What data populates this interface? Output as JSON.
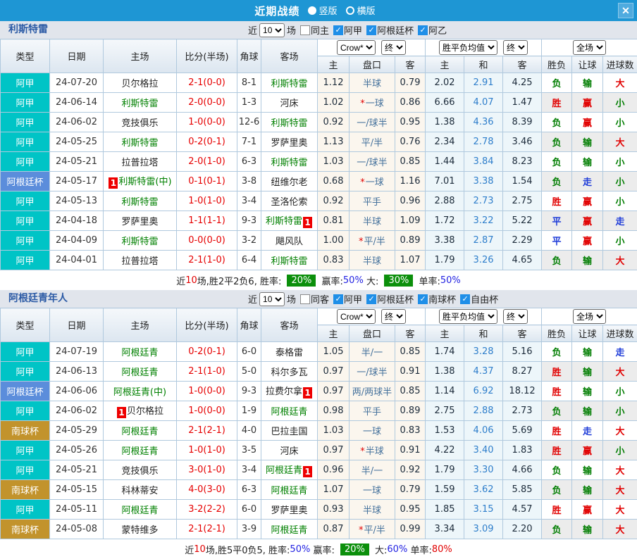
{
  "titlebar": {
    "title": "近期战绩",
    "view_modes": [
      {
        "label": "竖版",
        "selected": true
      },
      {
        "label": "横版",
        "selected": false
      }
    ],
    "close_label": "✕"
  },
  "table_head": {
    "main": [
      "类型",
      "日期",
      "主场",
      "比分(半场)",
      "角球",
      "客场"
    ],
    "odds": [
      "主",
      "盘口",
      "客"
    ],
    "avg": [
      "主",
      "和",
      "客"
    ],
    "result": [
      "胜负",
      "让球",
      "进球数"
    ]
  },
  "colors": {
    "topbar": "#1e96d4",
    "league": {
      "阿甲": "#00c4c6",
      "阿根廷杯": "#5b8ddb",
      "南球杯": "#c2932c"
    },
    "win_red": "#e10000",
    "lose_green": "#007d00",
    "draw_blue": "#1f3cd8"
  },
  "sections": [
    {
      "team": "利斯特雷",
      "filter": {
        "prefix": "近",
        "count": "10",
        "suffix": "场",
        "checkboxes": [
          {
            "label": "同主",
            "checked": false
          },
          {
            "label": "阿甲",
            "checked": true
          },
          {
            "label": "阿根廷杯",
            "checked": true
          },
          {
            "label": "阿乙",
            "checked": true
          }
        ]
      },
      "dropdowns": {
        "book": "Crow*",
        "book_period": "终",
        "avg": "胜平负均值",
        "avg_period": "终",
        "scope": "全场"
      },
      "rows": [
        {
          "lg": "阿甲",
          "date": "24-07-20",
          "home": {
            "t": "贝尔格拉"
          },
          "score": "2-1",
          "half": "(0-0)",
          "cor": "8-1",
          "away": {
            "t": "利斯特雷",
            "g": 1
          },
          "o1": "1.12",
          "hcap": "半球",
          "star": 0,
          "o2": "0.79",
          "a1": "2.02",
          "a2": "2.91",
          "a3": "4.25",
          "r": "负",
          "h": "输",
          "gl": "大"
        },
        {
          "lg": "阿甲",
          "date": "24-06-14",
          "home": {
            "t": "利斯特雷",
            "g": 1
          },
          "score": "2-0",
          "half": "(0-0)",
          "cor": "1-3",
          "away": {
            "t": "河床"
          },
          "o1": "1.02",
          "hcap": "一球",
          "star": 1,
          "o2": "0.86",
          "a1": "6.66",
          "a2": "4.07",
          "a3": "1.47",
          "r": "胜",
          "h": "赢",
          "gl": "小"
        },
        {
          "lg": "阿甲",
          "date": "24-06-02",
          "home": {
            "t": "竞技俱乐"
          },
          "score": "1-0",
          "half": "(0-0)",
          "cor": "12-6",
          "away": {
            "t": "利斯特雷",
            "g": 1
          },
          "o1": "0.92",
          "hcap": "一/球半",
          "star": 0,
          "o2": "0.95",
          "a1": "1.38",
          "a2": "4.36",
          "a3": "8.39",
          "r": "负",
          "h": "赢",
          "gl": "小"
        },
        {
          "lg": "阿甲",
          "date": "24-05-25",
          "home": {
            "t": "利斯特雷",
            "g": 1
          },
          "score": "0-2",
          "half": "(0-1)",
          "cor": "7-1",
          "away": {
            "t": "罗萨里奥"
          },
          "o1": "1.13",
          "hcap": "平/半",
          "star": 0,
          "o2": "0.76",
          "a1": "2.34",
          "a2": "2.78",
          "a3": "3.46",
          "r": "负",
          "h": "输",
          "gl": "大"
        },
        {
          "lg": "阿甲",
          "date": "24-05-21",
          "home": {
            "t": "拉普拉塔"
          },
          "score": "2-0",
          "half": "(1-0)",
          "cor": "6-3",
          "away": {
            "t": "利斯特雷",
            "g": 1
          },
          "o1": "1.03",
          "hcap": "一/球半",
          "star": 0,
          "o2": "0.85",
          "a1": "1.44",
          "a2": "3.84",
          "a3": "8.23",
          "r": "负",
          "h": "输",
          "gl": "小"
        },
        {
          "lg": "阿根廷杯",
          "date": "24-05-17",
          "home": {
            "t": "利斯特雷(中)",
            "g": 1,
            "b": "l"
          },
          "score": "0-1",
          "half": "(0-1)",
          "cor": "3-8",
          "away": {
            "t": "纽维尔老"
          },
          "o1": "0.68",
          "hcap": "一球",
          "star": 1,
          "o2": "1.16",
          "a1": "7.01",
          "a2": "3.38",
          "a3": "1.54",
          "r": "负",
          "h": "走",
          "gl": "小"
        },
        {
          "lg": "阿甲",
          "date": "24-05-13",
          "home": {
            "t": "利斯特雷",
            "g": 1
          },
          "score": "1-0",
          "half": "(1-0)",
          "cor": "3-4",
          "away": {
            "t": "圣洛伦索"
          },
          "o1": "0.92",
          "hcap": "平手",
          "star": 0,
          "o2": "0.96",
          "a1": "2.88",
          "a2": "2.73",
          "a3": "2.75",
          "r": "胜",
          "h": "赢",
          "gl": "小"
        },
        {
          "lg": "阿甲",
          "date": "24-04-18",
          "home": {
            "t": "罗萨里奥"
          },
          "score": "1-1",
          "half": "(1-1)",
          "cor": "9-3",
          "away": {
            "t": "利斯特雷",
            "g": 1,
            "b": "r"
          },
          "o1": "0.81",
          "hcap": "半球",
          "star": 0,
          "o2": "1.09",
          "a1": "1.72",
          "a2": "3.22",
          "a3": "5.22",
          "r": "平",
          "h": "赢",
          "gl": "走"
        },
        {
          "lg": "阿甲",
          "date": "24-04-09",
          "home": {
            "t": "利斯特雷",
            "g": 1
          },
          "score": "0-0",
          "half": "(0-0)",
          "cor": "3-2",
          "away": {
            "t": "飓风队"
          },
          "o1": "1.00",
          "hcap": "平/半",
          "star": 1,
          "o2": "0.89",
          "a1": "3.38",
          "a2": "2.87",
          "a3": "2.29",
          "r": "平",
          "h": "赢",
          "gl": "小"
        },
        {
          "lg": "阿甲",
          "date": "24-04-01",
          "home": {
            "t": "拉普拉塔"
          },
          "score": "2-1",
          "half": "(1-0)",
          "cor": "6-4",
          "away": {
            "t": "利斯特雷",
            "g": 1
          },
          "o1": "0.83",
          "hcap": "半球",
          "star": 0,
          "o2": "1.07",
          "a1": "1.79",
          "a2": "3.26",
          "a3": "4.65",
          "r": "负",
          "h": "输",
          "gl": "大"
        }
      ],
      "summary": [
        {
          "t": "近"
        },
        {
          "t": "10",
          "c": "red"
        },
        {
          "t": "场,胜2平2负6, 胜率: "
        },
        {
          "t": "20%",
          "c": "badge"
        },
        {
          "t": " 赢率:"
        },
        {
          "t": "50%",
          "c": "blue"
        },
        {
          "t": " 大: "
        },
        {
          "t": "30%",
          "c": "badge"
        },
        {
          "t": " 单率:"
        },
        {
          "t": "50%",
          "c": "blue"
        }
      ]
    },
    {
      "team": "阿根廷青年人",
      "filter": {
        "prefix": "近",
        "count": "10",
        "suffix": "场",
        "checkboxes": [
          {
            "label": "同客",
            "checked": false
          },
          {
            "label": "阿甲",
            "checked": true
          },
          {
            "label": "阿根廷杯",
            "checked": true
          },
          {
            "label": "南球杯",
            "checked": true
          },
          {
            "label": "自由杯",
            "checked": true
          }
        ]
      },
      "dropdowns": {
        "book": "Crow*",
        "book_period": "终",
        "avg": "胜平负均值",
        "avg_period": "终",
        "scope": "全场"
      },
      "rows": [
        {
          "lg": "阿甲",
          "date": "24-07-19",
          "home": {
            "t": "阿根廷青",
            "g": 1
          },
          "score": "0-2",
          "half": "(0-1)",
          "cor": "6-0",
          "away": {
            "t": "泰格雷"
          },
          "o1": "1.05",
          "hcap": "半/一",
          "star": 0,
          "o2": "0.85",
          "a1": "1.74",
          "a2": "3.28",
          "a3": "5.16",
          "r": "负",
          "h": "输",
          "gl": "走"
        },
        {
          "lg": "阿甲",
          "date": "24-06-13",
          "home": {
            "t": "阿根廷青",
            "g": 1
          },
          "score": "2-1",
          "half": "(1-0)",
          "cor": "5-0",
          "away": {
            "t": "科尔多瓦"
          },
          "o1": "0.97",
          "hcap": "一/球半",
          "star": 0,
          "o2": "0.91",
          "a1": "1.38",
          "a2": "4.37",
          "a3": "8.27",
          "r": "胜",
          "h": "输",
          "gl": "大"
        },
        {
          "lg": "阿根廷杯",
          "date": "24-06-06",
          "home": {
            "t": "阿根廷青(中)",
            "g": 1
          },
          "score": "1-0",
          "half": "(0-0)",
          "cor": "9-3",
          "away": {
            "t": "拉费尔拿",
            "b": "r"
          },
          "o1": "0.97",
          "hcap": "两/两球半",
          "star": 0,
          "o2": "0.85",
          "a1": "1.14",
          "a2": "6.92",
          "a3": "18.12",
          "r": "胜",
          "h": "输",
          "gl": "小"
        },
        {
          "lg": "阿甲",
          "date": "24-06-02",
          "home": {
            "t": "贝尔格拉",
            "b": "l"
          },
          "score": "1-0",
          "half": "(0-0)",
          "cor": "1-9",
          "away": {
            "t": "阿根廷青",
            "g": 1
          },
          "o1": "0.98",
          "hcap": "平手",
          "star": 0,
          "o2": "0.89",
          "a1": "2.75",
          "a2": "2.88",
          "a3": "2.73",
          "r": "负",
          "h": "输",
          "gl": "小"
        },
        {
          "lg": "南球杯",
          "date": "24-05-29",
          "home": {
            "t": "阿根廷青",
            "g": 1
          },
          "score": "2-1",
          "half": "(2-1)",
          "cor": "4-0",
          "away": {
            "t": "巴拉圭国"
          },
          "o1": "1.03",
          "hcap": "一球",
          "star": 0,
          "o2": "0.83",
          "a1": "1.53",
          "a2": "4.06",
          "a3": "5.69",
          "r": "胜",
          "h": "走",
          "gl": "大"
        },
        {
          "lg": "阿甲",
          "date": "24-05-26",
          "home": {
            "t": "阿根廷青",
            "g": 1
          },
          "score": "1-0",
          "half": "(1-0)",
          "cor": "3-5",
          "away": {
            "t": "河床"
          },
          "o1": "0.97",
          "hcap": "半球",
          "star": 1,
          "o2": "0.91",
          "a1": "4.22",
          "a2": "3.40",
          "a3": "1.83",
          "r": "胜",
          "h": "赢",
          "gl": "小"
        },
        {
          "lg": "阿甲",
          "date": "24-05-21",
          "home": {
            "t": "竞技俱乐"
          },
          "score": "3-0",
          "half": "(1-0)",
          "cor": "3-4",
          "away": {
            "t": "阿根廷青",
            "g": 1,
            "b": "r"
          },
          "o1": "0.96",
          "hcap": "半/一",
          "star": 0,
          "o2": "0.92",
          "a1": "1.79",
          "a2": "3.30",
          "a3": "4.66",
          "r": "负",
          "h": "输",
          "gl": "大"
        },
        {
          "lg": "南球杯",
          "date": "24-05-15",
          "home": {
            "t": "科林蒂安"
          },
          "score": "4-0",
          "half": "(3-0)",
          "cor": "6-3",
          "away": {
            "t": "阿根廷青",
            "g": 1
          },
          "o1": "1.07",
          "hcap": "一球",
          "star": 0,
          "o2": "0.79",
          "a1": "1.59",
          "a2": "3.62",
          "a3": "5.85",
          "r": "负",
          "h": "输",
          "gl": "大"
        },
        {
          "lg": "阿甲",
          "date": "24-05-11",
          "home": {
            "t": "阿根廷青",
            "g": 1
          },
          "score": "3-2",
          "half": "(2-2)",
          "cor": "6-0",
          "away": {
            "t": "罗萨里奥"
          },
          "o1": "0.93",
          "hcap": "半球",
          "star": 0,
          "o2": "0.95",
          "a1": "1.85",
          "a2": "3.15",
          "a3": "4.57",
          "r": "胜",
          "h": "赢",
          "gl": "大"
        },
        {
          "lg": "南球杯",
          "date": "24-05-08",
          "home": {
            "t": "蒙特维多"
          },
          "score": "2-1",
          "half": "(2-1)",
          "cor": "3-9",
          "away": {
            "t": "阿根廷青",
            "g": 1
          },
          "o1": "0.87",
          "hcap": "平/半",
          "star": 1,
          "o2": "0.99",
          "a1": "3.34",
          "a2": "3.09",
          "a3": "2.20",
          "r": "负",
          "h": "输",
          "gl": "大"
        }
      ],
      "summary": [
        {
          "t": "近"
        },
        {
          "t": "10",
          "c": "red"
        },
        {
          "t": "场,胜5平0负5, 胜率:"
        },
        {
          "t": "50%",
          "c": "blue"
        },
        {
          "t": " 赢率: "
        },
        {
          "t": "20%",
          "c": "badge"
        },
        {
          "t": " 大:"
        },
        {
          "t": "60%",
          "c": "blue"
        },
        {
          "t": " 单率:"
        },
        {
          "t": "80%",
          "c": "red"
        }
      ]
    }
  ]
}
